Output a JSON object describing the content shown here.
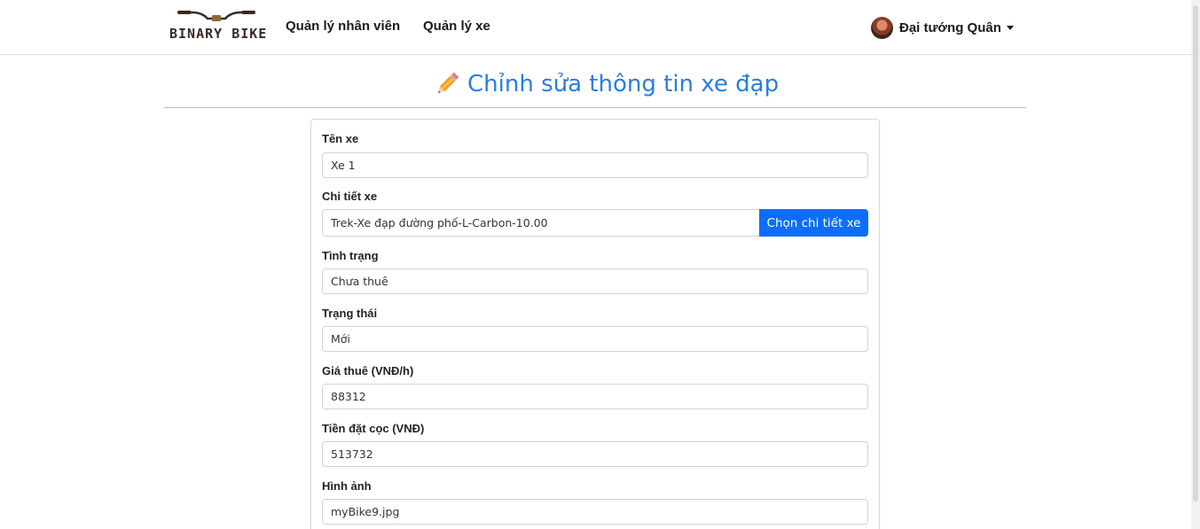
{
  "brand": {
    "name": "BINARY BIKE"
  },
  "nav": {
    "links": [
      "Quản lý nhân viên",
      "Quản lý xe"
    ]
  },
  "user": {
    "name": "Đại tướng Quân"
  },
  "page": {
    "title": "Chỉnh sửa thông tin xe đạp"
  },
  "form": {
    "bike_name": {
      "label": "Tên xe",
      "value": "Xe 1"
    },
    "bike_detail": {
      "label": "Chi tiết xe",
      "value": "Trek-Xe đạp đường phố-L-Carbon-10.00",
      "button": "Chọn chi tiết xe"
    },
    "condition": {
      "label": "Tình trạng",
      "value": "Chưa thuê"
    },
    "status": {
      "label": "Trạng thái",
      "value": "Mới"
    },
    "rental_price": {
      "label": "Giá thuê (VNĐ/h)",
      "value": "88312"
    },
    "deposit": {
      "label": "Tiền đặt cọc (VNĐ)",
      "value": "513732"
    },
    "image": {
      "label": "Hình ảnh",
      "value": "myBike9.jpg"
    }
  },
  "colors": {
    "accent": "#0d6efd",
    "title": "#2a7de1",
    "brand_text": "#3a2a24"
  }
}
